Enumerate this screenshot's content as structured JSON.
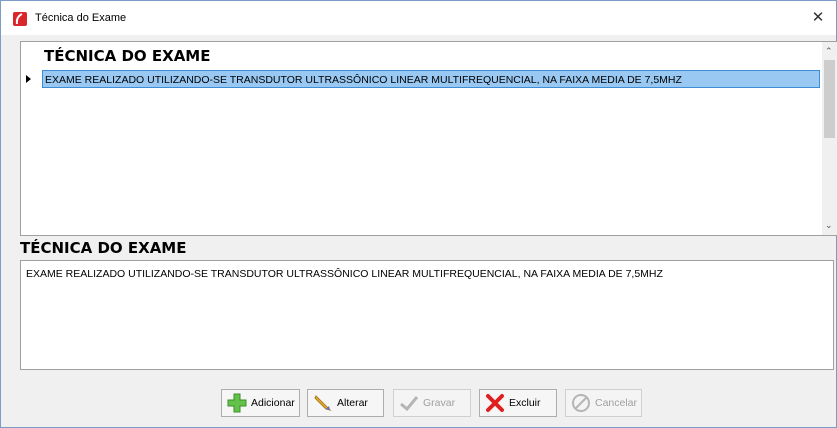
{
  "window": {
    "title": "Técnica do Exame",
    "close_glyph": "✕"
  },
  "grid": {
    "header": "TÉCNICA DO EXAME",
    "rows": [
      {
        "text": "EXAME REALIZADO UTILIZANDO-SE TRANSDUTOR ULTRASSÔNICO LINEAR MULTIFREQUENCIAL, NA FAIXA MEDIA DE 7,5MHZ"
      }
    ],
    "scroll_up": "⌃",
    "scroll_down": "⌄"
  },
  "detail": {
    "label": "TÉCNICA DO EXAME",
    "value": "EXAME REALIZADO UTILIZANDO-SE TRANSDUTOR ULTRASSÔNICO LINEAR MULTIFREQUENCIAL, NA FAIXA MEDIA DE 7,5MHZ"
  },
  "buttons": {
    "add": "Adicionar",
    "edit": "Alterar",
    "save": "Gravar",
    "delete": "Excluir",
    "cancel": "Cancelar"
  },
  "colors": {
    "selection": "#99c9f3",
    "app_icon": "#d9262b",
    "add_icon": "#62c24a",
    "delete_icon": "#e02020"
  }
}
